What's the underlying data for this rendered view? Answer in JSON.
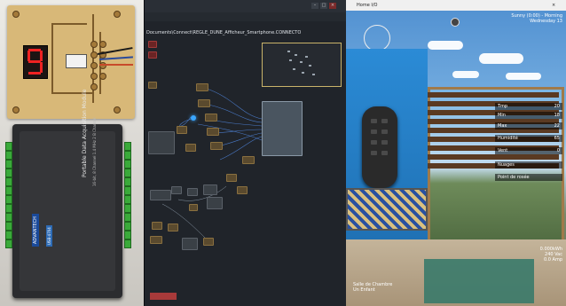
{
  "photo": {
    "daq_title": "Portable Data Acquisition Module",
    "daq_subtitle": "16-bit, 8 Channel 1.4 MHz 2 B Channel",
    "daq_brand": "ADVANTECH",
    "daq_model": "USB-4704"
  },
  "editor": {
    "path": "Documents\\Connect\\REGLE_DUNE_Afficheur_Smartphone.CONNECTO",
    "window_buttons": [
      "–",
      "□",
      "×"
    ]
  },
  "home": {
    "title": "Home I/O",
    "hud_top_line1": "Sunny (0:00) - Morning",
    "hud_top_line2": "Wednesday 13",
    "stats": [
      {
        "label": "Tmp",
        "value": "20"
      },
      {
        "label": "Min",
        "value": "18"
      },
      {
        "label": "Max",
        "value": "22"
      },
      {
        "label": "Humidité",
        "value": "65"
      },
      {
        "label": "Vent",
        "value": "0"
      },
      {
        "label": "Nuages",
        "value": ""
      },
      {
        "label": "Point de rosée",
        "value": ""
      }
    ],
    "bottom_left_line1": "Salle de Chambre",
    "bottom_left_line2": "Un Enfant",
    "bottom_right_line1": "0.000kWh",
    "bottom_right_line2": "240 Vac",
    "bottom_right_line3": "0.0 Amp"
  }
}
